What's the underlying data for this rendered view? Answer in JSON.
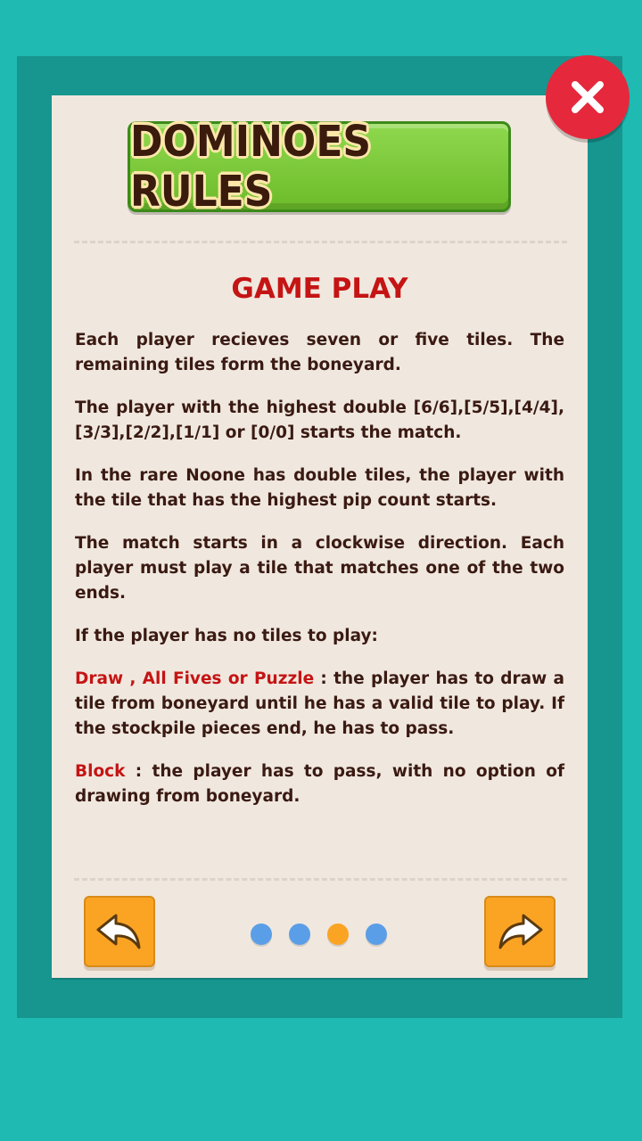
{
  "title": "DOMINOES RULES",
  "section_heading": "GAME PLAY",
  "paragraphs": {
    "p1": "Each player recieves seven or five tiles. The remaining tiles form the boneyard.",
    "p2": "The player with the highest double [6/6],[5/5],[4/4],[3/3],[2/2],[1/1] or [0/0] starts the match.",
    "p3": "In the rare Noone has double tiles, the player with the tile that has the highest pip count starts.",
    "p4": "The match starts in a clockwise direction. Each player must play a tile that matches one of the two ends.",
    "p5": "If the player has no tiles to play:",
    "p6_label": "Draw , All Fives or Puzzle",
    "p6_text": " : the player has to draw a tile from boneyard until he has a valid tile to play. If the stockpile pieces end, he has to pass.",
    "p7_label": "Block",
    "p7_text": " : the player has to pass, with no option of drawing from boneyard."
  },
  "pagination": {
    "total_pages": 4,
    "current_page": 3
  },
  "icons": {
    "close": "close-icon",
    "back": "back-arrow-icon",
    "forward": "forward-arrow-icon"
  },
  "colors": {
    "background": "#1fbab2",
    "frame": "#17958f",
    "paper": "#f0e8df",
    "heading_red": "#c51414",
    "body_text": "#3a1a12",
    "banner_green": "#7ccb3a",
    "close_red": "#e6283c",
    "button_orange": "#fba424",
    "dot_inactive": "#5b9ee8",
    "dot_active": "#fba424"
  }
}
